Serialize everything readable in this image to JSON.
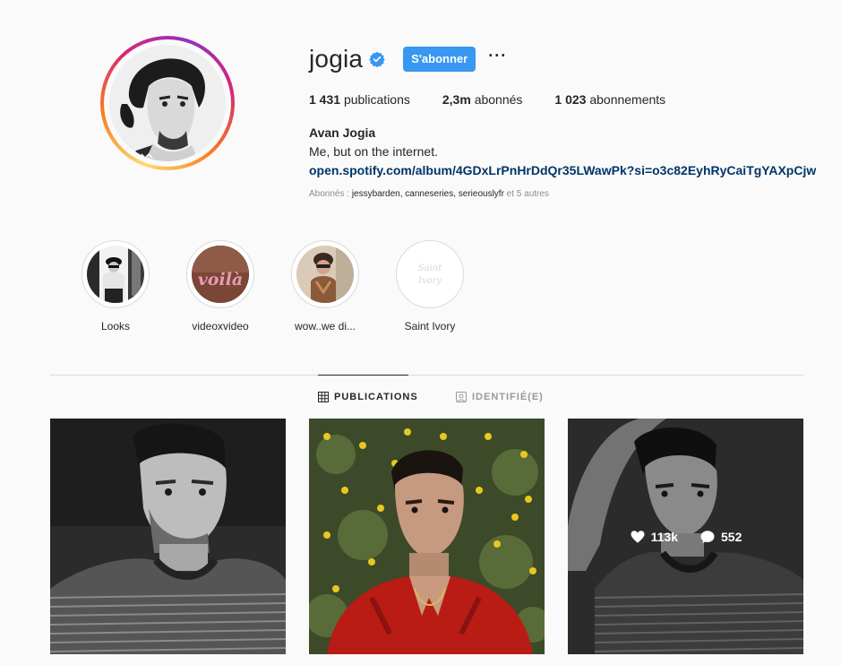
{
  "profile": {
    "username": "jogia",
    "follow_label": "S'abonner",
    "more_label": "···",
    "stats": {
      "posts_count": "1 431",
      "posts_label": "publications",
      "followers_count": "2,3m",
      "followers_label": "abonnés",
      "following_count": "1 023",
      "following_label": "abonnements"
    },
    "full_name": "Avan Jogia",
    "bio": "Me, but on the internet.",
    "link": "open.spotify.com/album/4GDxLrPnHrDdQr35LWawPk?si=o3c82EyhRyCaiTgYAXpCjw",
    "followed_by": {
      "prefix": "Abonnés : ",
      "users": "jessybarden, canneseries, serieouslyfr",
      "suffix": " et 5 autres"
    }
  },
  "stories": [
    {
      "label": "Looks"
    },
    {
      "label": "videoxvideo",
      "image_text": "voilà"
    },
    {
      "label": "wow..we di..."
    },
    {
      "label": "Saint Ivory",
      "image_text_line1": "Saint",
      "image_text_line2": "Ivory"
    }
  ],
  "tabs": [
    {
      "label": "PUBLICATIONS",
      "icon": "grid-icon",
      "active": true
    },
    {
      "label": "IDENTIFIÉ(E)",
      "icon": "tagged-icon",
      "active": false
    }
  ],
  "posts": [
    {
      "kind": "bw-portrait"
    },
    {
      "kind": "color-portrait"
    },
    {
      "kind": "bw-portrait-arm",
      "likes": "113k",
      "comments": "552"
    }
  ],
  "colors": {
    "follow_button": "#3897f0",
    "link": "#003569",
    "verified": "#3897f0",
    "muted": "#8e8e8e"
  }
}
